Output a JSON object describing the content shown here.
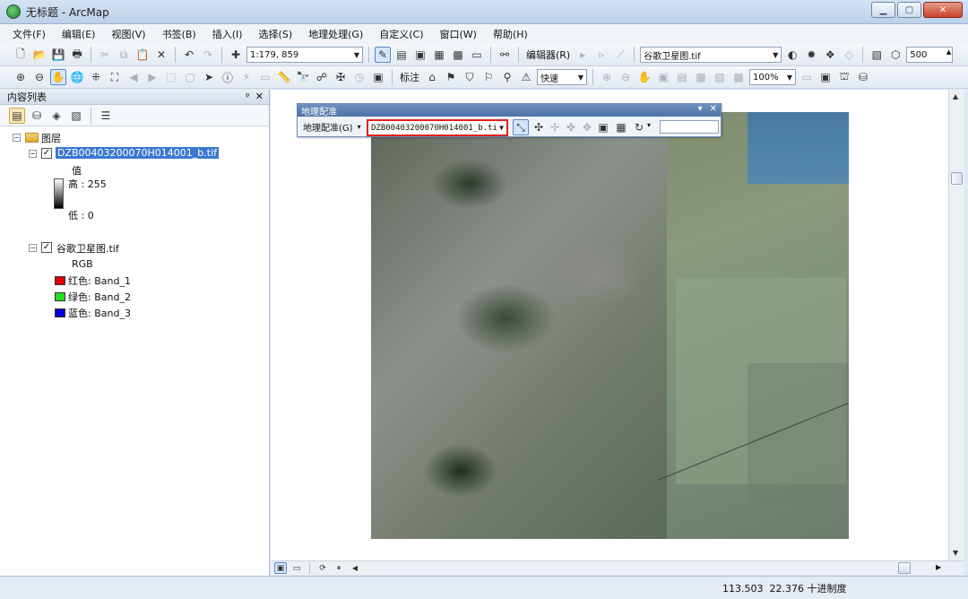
{
  "window": {
    "title": "无标题 - ArcMap"
  },
  "menu": [
    "文件(F)",
    "编辑(E)",
    "视图(V)",
    "书签(B)",
    "插入(I)",
    "选择(S)",
    "地理处理(G)",
    "自定义(C)",
    "窗口(W)",
    "帮助(H)"
  ],
  "toolbar1": {
    "scale": "1:179, 859",
    "editor_label": "编辑器(R)",
    "layer_combo": "谷歌卫星图.tif",
    "spin_value": "500"
  },
  "toolbar2": {
    "annotation_label": "标注",
    "quick_combo": "快速",
    "zoom_percent": "100%"
  },
  "toc": {
    "title": "内容列表",
    "pin_glyph": "ᵖ",
    "close_glyph": "✕",
    "root": "图层",
    "layer1": {
      "name": "DZB00403200070H014001_b.tif",
      "value_label": "值",
      "high_label": "高 : 255",
      "low_label": "低 : 0"
    },
    "layer2": {
      "name": "谷歌卫星图.tif",
      "rgb_label": "RGB",
      "bands": [
        {
          "label": "红色:   Band_1",
          "color": "#e00000"
        },
        {
          "label": "绿色: Band_2",
          "color": "#22dd22"
        },
        {
          "label": "蓝色:   Band_3",
          "color": "#0000d8"
        }
      ]
    }
  },
  "georef": {
    "title": "地理配准",
    "menu_label": "地理配准(G)",
    "layer_combo": "DZB00403200070H014001_b.ti"
  },
  "status": {
    "x": "113.503",
    "y": "22.376",
    "units": "十进制度"
  }
}
